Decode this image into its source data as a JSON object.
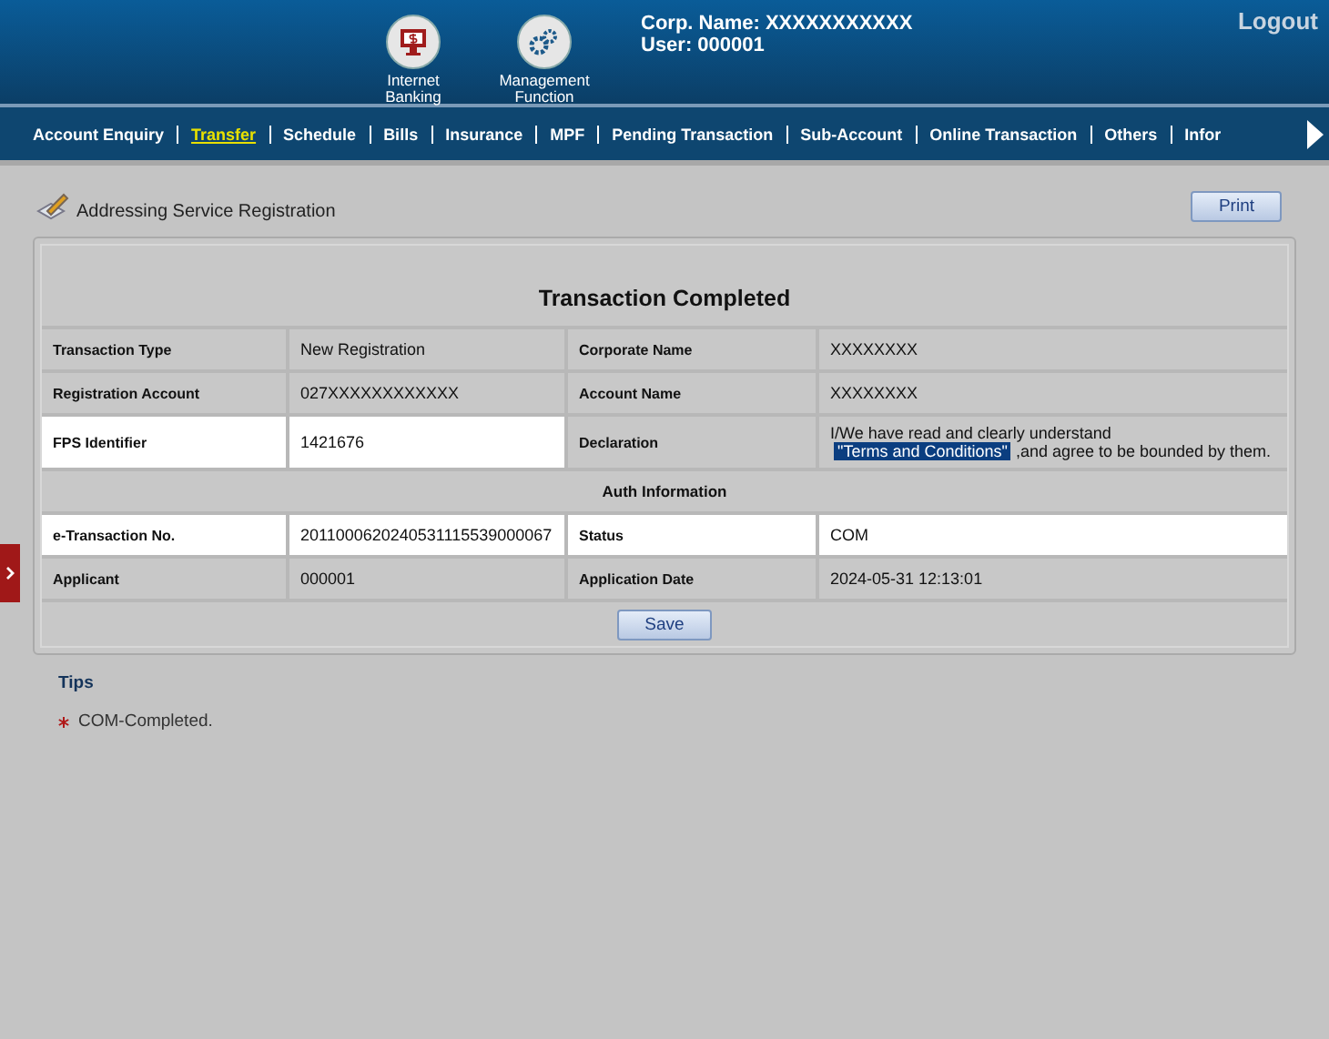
{
  "header": {
    "apps": [
      {
        "label": "Internet Banking",
        "kind": "banking"
      },
      {
        "label": "Management Function",
        "kind": "management"
      }
    ],
    "corp_name": "Corp. Name: XXXXXXXXXXX",
    "user": "User: 000001",
    "logout": "Logout"
  },
  "nav": [
    {
      "label": "Account Enquiry",
      "selected": false
    },
    {
      "label": "Transfer",
      "selected": true
    },
    {
      "label": "Schedule",
      "selected": false
    },
    {
      "label": "Bills",
      "selected": false
    },
    {
      "label": "Insurance",
      "selected": false
    },
    {
      "label": "MPF",
      "selected": false
    },
    {
      "label": "Pending Transaction",
      "selected": false
    },
    {
      "label": "Sub-Account",
      "selected": false
    },
    {
      "label": "Online Transaction",
      "selected": false
    },
    {
      "label": "Others",
      "selected": false
    },
    {
      "label": "Infor",
      "selected": false
    }
  ],
  "page_title": "Addressing Service Registration",
  "print_button": "Print",
  "result": {
    "title": "Transaction Completed",
    "rows": [
      {
        "kind": "pair",
        "left_highlighted": false,
        "right_highlighted": false,
        "left": {
          "label": "Transaction Type",
          "value": "New Registration"
        },
        "right": {
          "label": "Corporate Name",
          "value": "XXXXXXXX"
        }
      },
      {
        "kind": "pair",
        "left_highlighted": false,
        "right_highlighted": false,
        "left": {
          "label": "Registration Account",
          "value": "027XXXXXXXXXXXX"
        },
        "right": {
          "label": "Account Name",
          "value": "XXXXXXXX"
        }
      },
      {
        "kind": "pair",
        "left_highlighted": true,
        "right_highlighted": false,
        "left": {
          "label": "FPS Identifier",
          "value": "1421676"
        },
        "right": {
          "label": "Declaration",
          "value": "I/We have read and clearly understand",
          "link": "\"Terms and Conditions\"",
          "after": ",and agree to be bounded by them."
        }
      },
      {
        "kind": "section",
        "label": "Auth Information"
      },
      {
        "kind": "pair",
        "left_highlighted": true,
        "right_highlighted": true,
        "left": {
          "label": "e-Transaction No.",
          "value": "2011000620240531115539000067"
        },
        "right": {
          "label": "Status",
          "value": "COM"
        }
      },
      {
        "kind": "pair",
        "left_highlighted": false,
        "right_highlighted": false,
        "left": {
          "label": "Applicant",
          "value": "000001"
        },
        "right": {
          "label": "Application Date",
          "value": "2024-05-31 12:13:01"
        }
      }
    ],
    "save_button": "Save"
  },
  "tips": {
    "title": "Tips",
    "items": [
      "COM-Completed."
    ]
  }
}
